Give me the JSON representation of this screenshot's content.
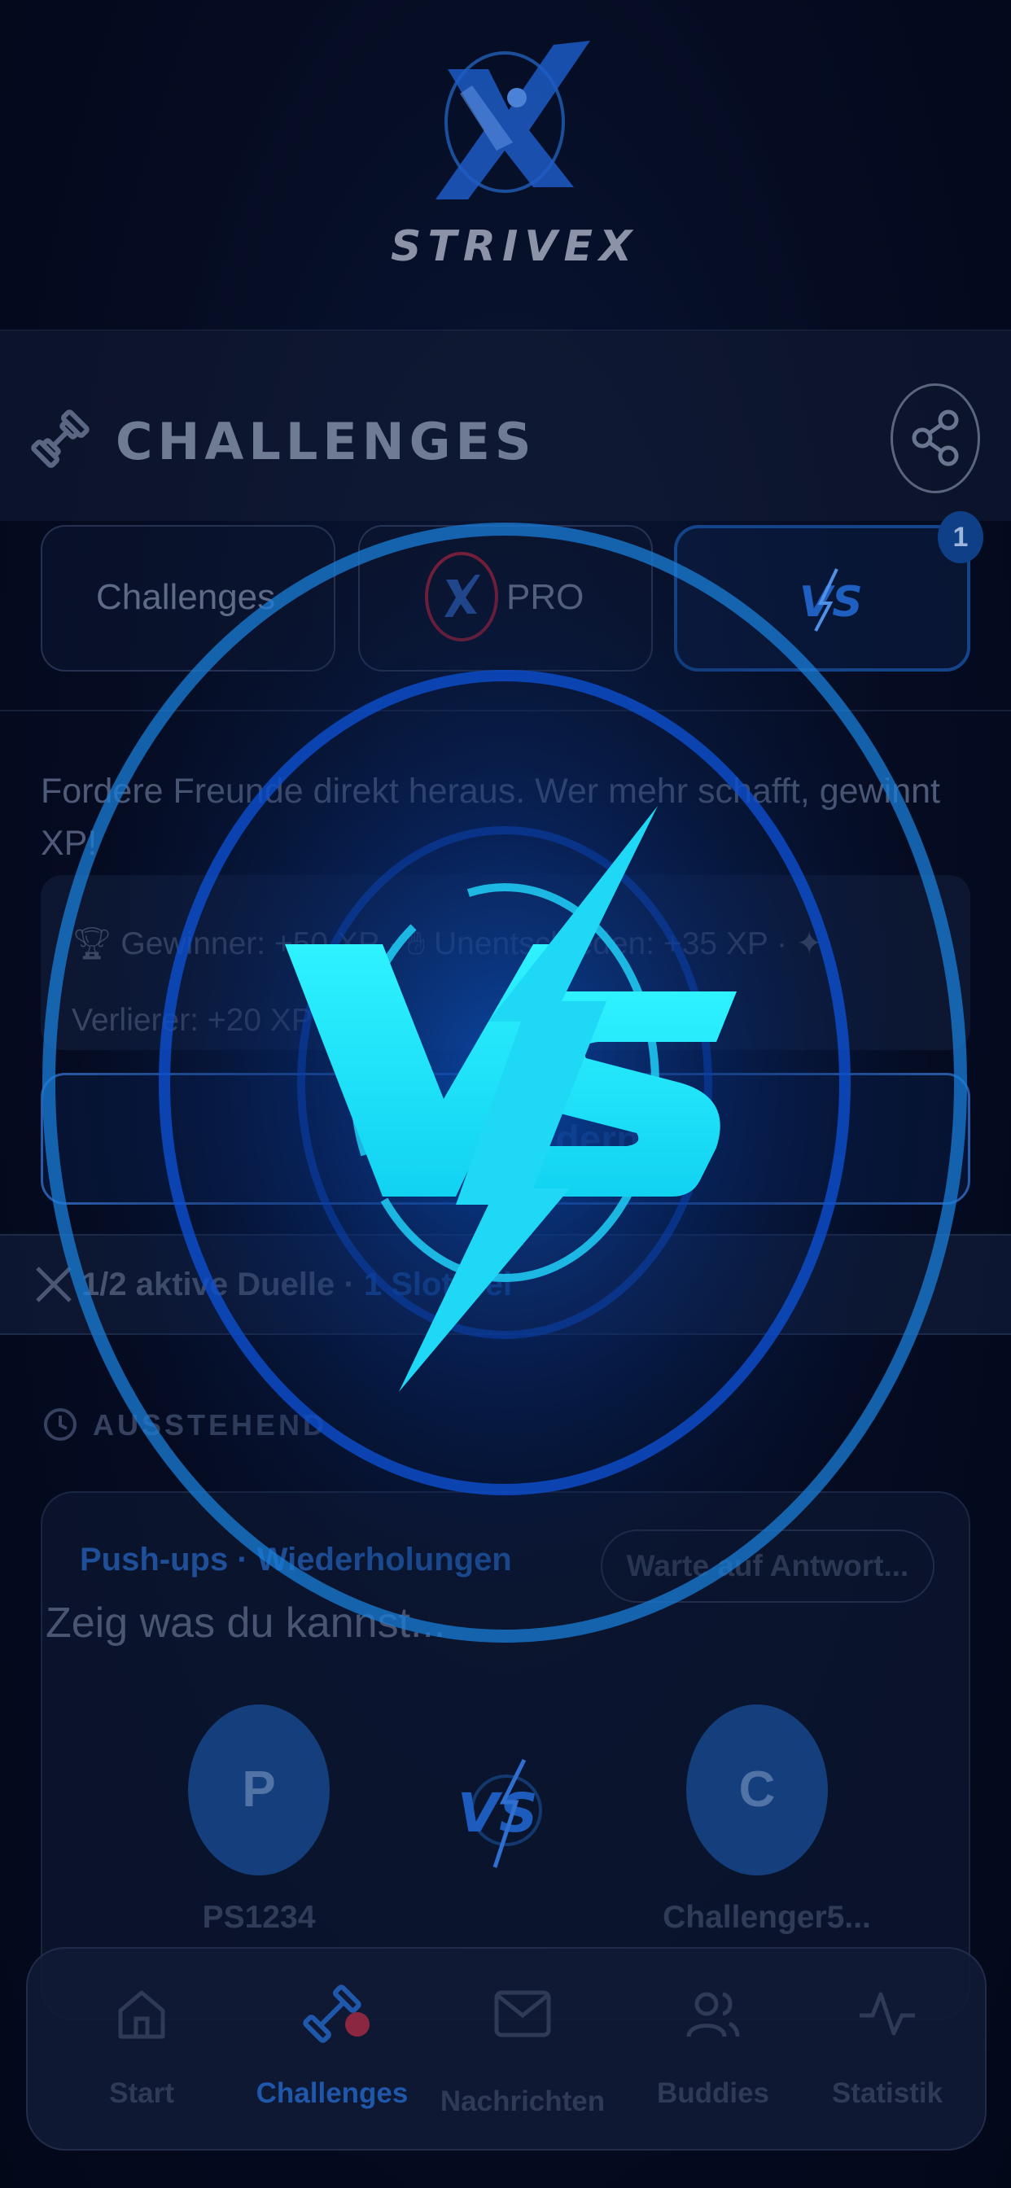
{
  "brand": {
    "logo_text": "STRIVEX"
  },
  "header": {
    "title": "CHALLENGES",
    "share_icon": "share-icon",
    "title_icon": "dumbbell-icon"
  },
  "tabs": [
    {
      "label": "Challenges"
    },
    {
      "label": "PRO"
    },
    {
      "label": "VS",
      "badge": "1"
    }
  ],
  "intro": "Fordere Freunde direkt heraus. Wer mehr schafft, gewinnt XP!",
  "xp_info": {
    "winner": "Gewinner: +50 XP",
    "draw": "Unentschieden: +35 XP",
    "loser": "Verlierer: +20 XP"
  },
  "cta": {
    "label": "Herausfordern"
  },
  "duels": {
    "active": "1/2 aktive Duelle",
    "separator": "·",
    "slot": "1 Slot frei"
  },
  "pending": {
    "heading": "AUSSTEHEND",
    "card": {
      "type": "Push-ups · Wiederholungen",
      "status": "Warte auf Antwort...",
      "message": "Zeig was du kannst...",
      "player1": {
        "initial": "P",
        "name": "PS1234"
      },
      "player2": {
        "initial": "C",
        "name": "Challenger5..."
      }
    }
  },
  "nav": [
    {
      "label": "Start",
      "icon": "home-icon"
    },
    {
      "label": "Challenges",
      "icon": "dumbbell-icon",
      "active": true
    },
    {
      "label": "Nachrichten",
      "icon": "mail-icon"
    },
    {
      "label": "Buddies",
      "icon": "users-icon"
    },
    {
      "label": "Statistik",
      "icon": "activity-icon"
    }
  ],
  "colors": {
    "accent": "#1f57aa",
    "vs_glow": "#19e6ff",
    "background": "#03091c"
  }
}
